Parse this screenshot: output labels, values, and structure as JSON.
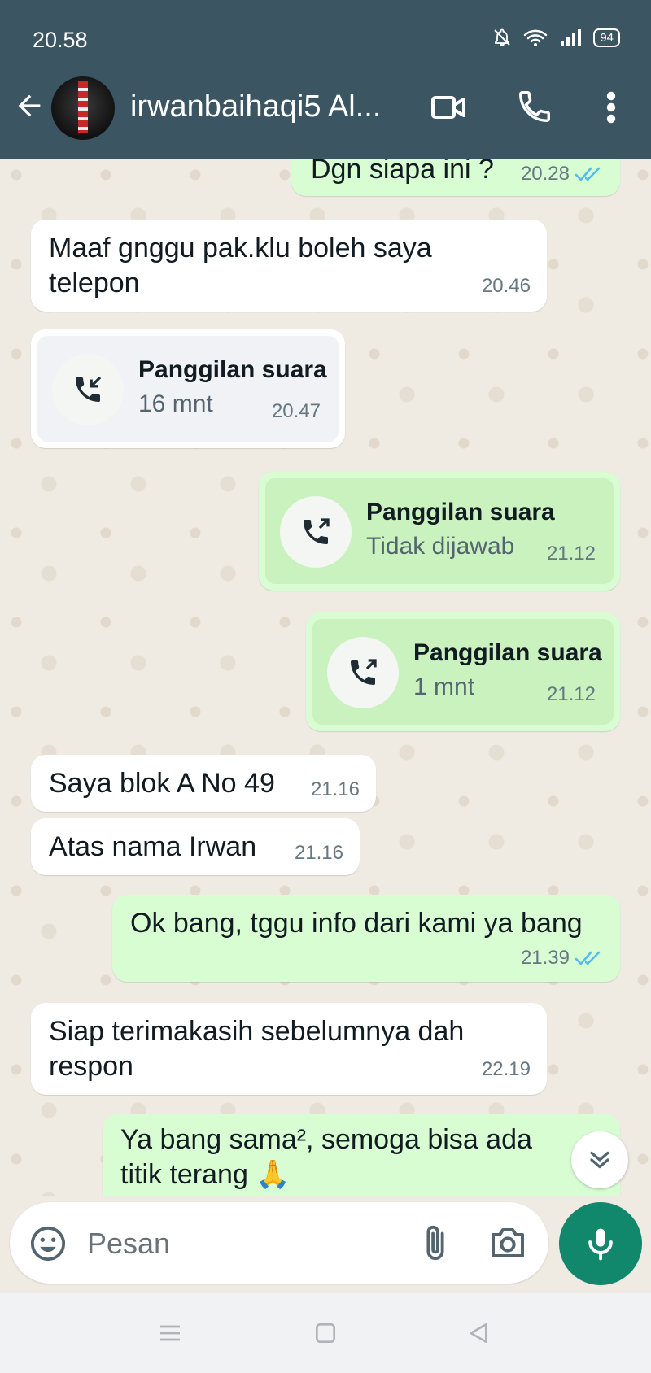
{
  "status_bar": {
    "time": "20.58",
    "battery": "94"
  },
  "header": {
    "contact_name": "irwanbaihaqi5 Al..."
  },
  "messages": [
    {
      "text": "Dgn siapa ini ?",
      "time": "20.28"
    },
    {
      "text": "Maaf gnggu pak.klu boleh saya telepon",
      "time": "20.46"
    },
    {
      "title": "Panggilan suara",
      "subtitle": "16 mnt",
      "time": "20.47"
    },
    {
      "title": "Panggilan suara",
      "subtitle": "Tidak dijawab",
      "time": "21.12"
    },
    {
      "title": "Panggilan suara",
      "subtitle": "1 mnt",
      "time": "21.12"
    },
    {
      "text": "Saya blok A No 49",
      "time": "21.16"
    },
    {
      "text": "Atas nama Irwan",
      "time": "21.16"
    },
    {
      "text": "Ok bang, tggu info dari kami ya bang",
      "time": "21.39"
    },
    {
      "text": "Siap terimakasih sebelumnya dah respon",
      "time": "22.19"
    },
    {
      "text": "Ya bang sama², semoga bisa ada titik terang 🙏"
    }
  ],
  "composer": {
    "placeholder": "Pesan"
  },
  "colors": {
    "header": "#3b5562",
    "outgoing_bubble": "#d9fdd3",
    "incoming_bubble": "#ffffff",
    "accent": "#11876b",
    "read_ticks": "#53bdeb"
  },
  "icons": [
    "back-arrow-icon",
    "video-call-icon",
    "phone-icon",
    "more-vert-icon",
    "incoming-call-icon",
    "outgoing-call-icon",
    "double-check-icon",
    "chevron-double-down-icon",
    "emoji-icon",
    "paperclip-icon",
    "camera-icon",
    "mic-icon"
  ]
}
